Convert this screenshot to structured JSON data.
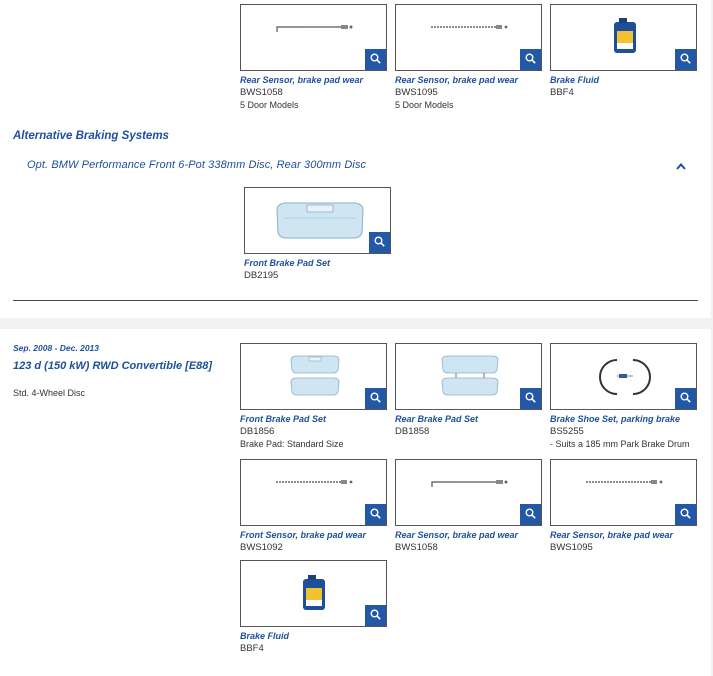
{
  "top_cards": [
    {
      "title": "Rear Sensor, brake pad wear",
      "code": "BWS1058",
      "note": "5 Door Models",
      "image": "wear-sensor-bent"
    },
    {
      "title": "Rear Sensor, brake pad wear",
      "code": "BWS1095",
      "note": "5 Door Models",
      "image": "wear-sensor"
    },
    {
      "title": "Brake Fluid",
      "code": "BBF4",
      "note": "",
      "image": "brake-fluid-bottle"
    }
  ],
  "alternative": {
    "heading": "Alternative Braking Systems",
    "option_title": "Opt. BMW Performance Front 6-Pot 338mm Disc, Rear 300mm Disc",
    "toggle_icon": "chevron-up-icon",
    "cards": [
      {
        "title": "Front Brake Pad Set",
        "code": "DB2195",
        "note": "",
        "image": "brake-pad-large"
      }
    ]
  },
  "vehicle": {
    "date_range": "Sep. 2008 - Dec. 2013",
    "model": "123 d (150 kW) RWD Convertible [E88]",
    "variant": "Std. 4-Wheel Disc",
    "cards": [
      {
        "title": "Front Brake Pad Set",
        "code": "DB1856",
        "note": "Brake Pad: Standard Size",
        "image": "brake-pad-pair"
      },
      {
        "title": "Rear Brake Pad Set",
        "code": "DB1858",
        "note": "",
        "image": "brake-pad-pair-rear"
      },
      {
        "title": "Brake Shoe Set, parking brake",
        "code": "BS5255",
        "note": "- Suits a 185 mm Park Brake Drum",
        "image": "brake-shoe"
      },
      {
        "title": "Front Sensor, brake pad wear",
        "code": "BWS1092",
        "note": "",
        "image": "wear-sensor"
      },
      {
        "title": "Rear Sensor, brake pad wear",
        "code": "BWS1058",
        "note": "",
        "image": "wear-sensor-bent"
      },
      {
        "title": "Rear Sensor, brake pad wear",
        "code": "BWS1095",
        "note": "",
        "image": "wear-sensor"
      },
      {
        "title": "Brake Fluid",
        "code": "BBF4",
        "note": "",
        "image": "brake-fluid-bottle"
      }
    ]
  },
  "colors": {
    "accent": "#1d4f9a",
    "zoom_button": "#2258a5",
    "pad_fill": "#cfe6f2"
  },
  "zoom_icon": "magnifier-icon"
}
